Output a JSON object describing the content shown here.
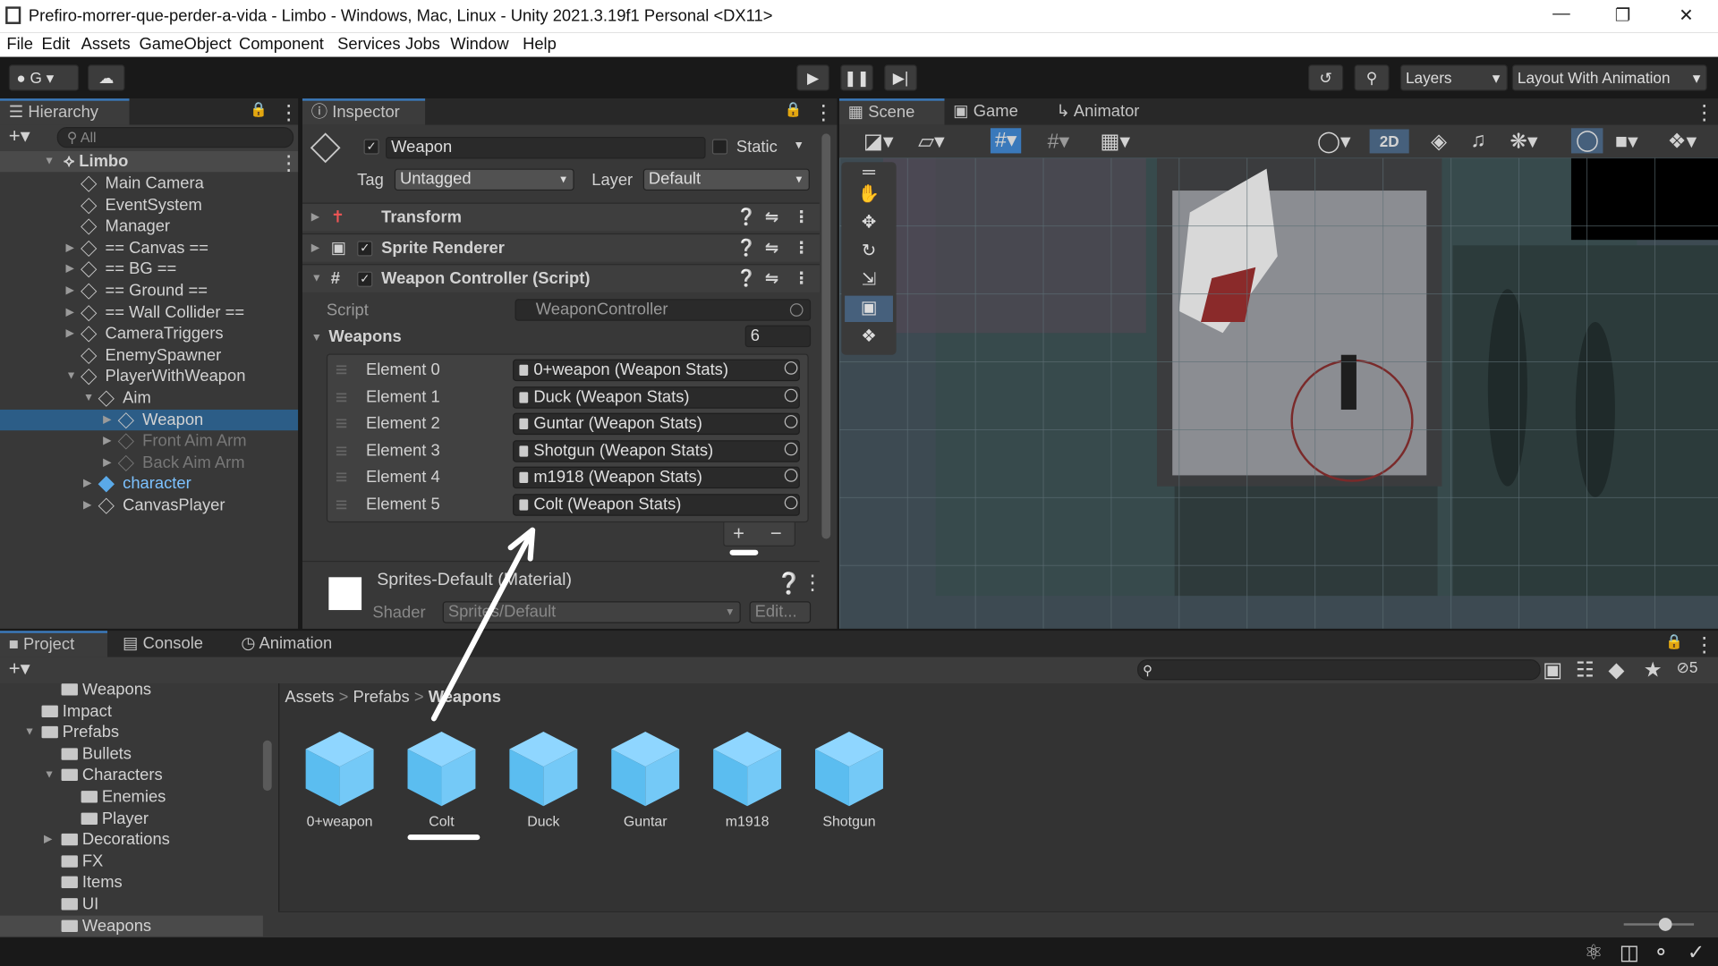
{
  "window": {
    "title": "Prefiro-morrer-que-perder-a-vida - Limbo - Windows, Mac, Linux - Unity 2021.3.19f1 Personal <DX11>"
  },
  "menu": [
    "File",
    "Edit",
    "Assets",
    "GameObject",
    "Component",
    "Services",
    "Jobs",
    "Window",
    "Help"
  ],
  "toolbar": {
    "account": "G",
    "layers": "Layers",
    "layout": "Layout With Animation"
  },
  "hierarchy": {
    "tab": "Hierarchy",
    "search_placeholder": "All",
    "scene": "Limbo",
    "items": [
      "Main Camera",
      "EventSystem",
      "Manager",
      "== Canvas ==",
      "== BG ==",
      "== Ground ==",
      "== Wall Collider ==",
      "CameraTriggers",
      "EnemySpawner",
      "PlayerWithWeapon",
      "Aim",
      "Weapon",
      "Front Aim Arm",
      "Back Aim Arm",
      "character",
      "CanvasPlayer"
    ]
  },
  "inspector": {
    "tab": "Inspector",
    "object_name": "Weapon",
    "static_label": "Static",
    "tag_label": "Tag",
    "tag_value": "Untagged",
    "layer_label": "Layer",
    "layer_value": "Default",
    "components": [
      "Transform",
      "Sprite Renderer",
      "Weapon Controller (Script)"
    ],
    "script_label": "Script",
    "script_value": "WeaponController",
    "weapons_label": "Weapons",
    "weapons_count": "6",
    "elements": [
      {
        "label": "Element 0",
        "value": "0+weapon (Weapon Stats)"
      },
      {
        "label": "Element 1",
        "value": "Duck (Weapon Stats)"
      },
      {
        "label": "Element 2",
        "value": "Guntar (Weapon Stats)"
      },
      {
        "label": "Element 3",
        "value": "Shotgun (Weapon Stats)"
      },
      {
        "label": "Element 4",
        "value": "m1918 (Weapon Stats)"
      },
      {
        "label": "Element 5",
        "value": "Colt (Weapon Stats)"
      }
    ],
    "material_name": "Sprites-Default (Material)",
    "shader_label": "Shader",
    "shader_value": "Sprites/Default",
    "edit_button": "Edit..."
  },
  "scene_view": {
    "tabs": [
      "Scene",
      "Game",
      "Animator"
    ],
    "mode_2d": "2D"
  },
  "project": {
    "tabs": [
      "Project",
      "Console",
      "Animation"
    ],
    "badge": "5",
    "breadcrumb": [
      "Assets",
      "Prefabs",
      "Weapons"
    ],
    "tree": [
      "Weapons",
      "Impact",
      "Prefabs",
      "Bullets",
      "Characters",
      "Enemies",
      "Player",
      "Decorations",
      "FX",
      "Items",
      "UI",
      "Weapons"
    ],
    "assets": [
      "0+weapon",
      "Colt",
      "Duck",
      "Guntar",
      "m1918",
      "Shotgun"
    ]
  }
}
